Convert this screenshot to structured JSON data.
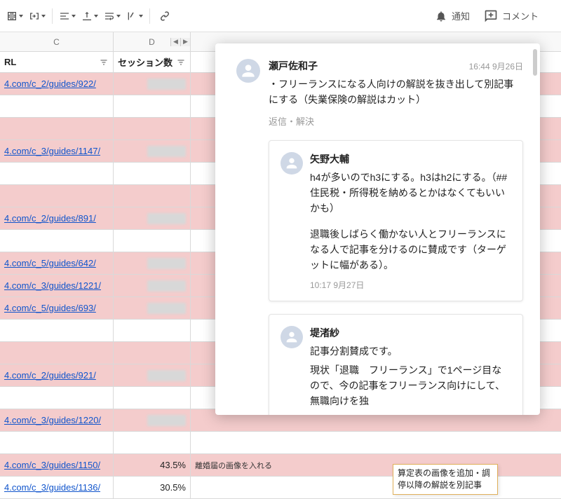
{
  "toolbar": {
    "notify_label": "通知",
    "comment_label": "コメント"
  },
  "columns": {
    "c": "C",
    "d": "D",
    "header_c": "RL",
    "header_d": "セッション数"
  },
  "rows": [
    {
      "url": "4.com/c_2/guides/922/",
      "pink": true
    },
    {
      "url": "",
      "pink": false
    },
    {
      "url": "",
      "pink": true
    },
    {
      "url": "4.com/c_3/guides/1147/",
      "pink": true
    },
    {
      "url": "",
      "pink": false
    },
    {
      "url": "",
      "pink": true
    },
    {
      "url": "4.com/c_2/guides/891/",
      "pink": true
    },
    {
      "url": "",
      "pink": false
    },
    {
      "url": "4.com/c_5/guides/642/",
      "pink": true
    },
    {
      "url": "4.com/c_3/guides/1221/",
      "pink": true
    },
    {
      "url": "4.com/c_5/guides/693/",
      "pink": true
    },
    {
      "url": "",
      "pink": false
    },
    {
      "url": "",
      "pink": true
    },
    {
      "url": "4.com/c_2/guides/921/",
      "pink": true
    },
    {
      "url": "",
      "pink": false
    },
    {
      "url": "4.com/c_3/guides/1220/",
      "pink": true
    },
    {
      "url": "",
      "pink": false
    },
    {
      "url": "4.com/c_3/guides/1150/",
      "pink": true,
      "pct": "43.5%",
      "etext": "離婚届の画像を入れる"
    },
    {
      "url": "4.com/c_3/guides/1136/",
      "pink": false,
      "pct": "30.5%"
    }
  ],
  "note": "算定表の画像を追加・調停以降の解説を別記事",
  "thread": {
    "author": "瀬戸佐和子",
    "timestamp": "16:44 9月26日",
    "text": "・フリーランスになる人向けの解説を抜き出して別記事にする（失業保険の解説はカット）",
    "actions": "返信・解決",
    "replies": [
      {
        "author": "矢野大輔",
        "text1": "h4が多いのでh3にする。h3はh2にする。（## 住民税・所得税を納めるとかはなくてもいいかも）",
        "text2": "退職後しばらく働かない人とフリーランスになる人で記事を分けるのに賛成です（ターゲットに幅がある）。",
        "timestamp": "10:17 9月27日"
      },
      {
        "author": "堤渚紗",
        "text1": "記事分割賛成です。",
        "text2": "現状「退職　フリーランス」で1ページ目なので、今の記事をフリーランス向けにして、無職向けを独",
        "timestamp": ""
      }
    ]
  }
}
